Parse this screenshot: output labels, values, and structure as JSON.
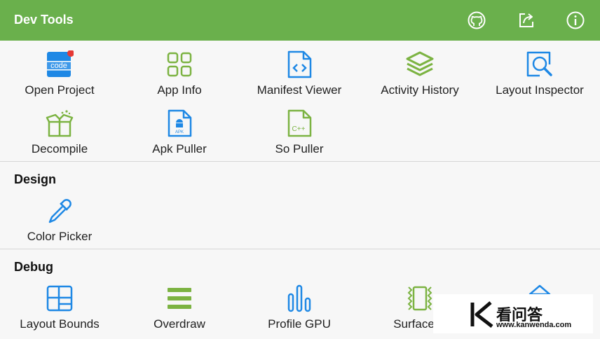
{
  "appbar": {
    "title": "Dev Tools",
    "color": "#6ab04c",
    "actions": [
      {
        "name": "github",
        "icon": "github-icon"
      },
      {
        "name": "share",
        "icon": "share-icon"
      },
      {
        "name": "info",
        "icon": "info-icon"
      }
    ]
  },
  "tools": {
    "items": [
      {
        "label": "Open Project",
        "icon": "code-icon"
      },
      {
        "label": "App Info",
        "icon": "grid-icon"
      },
      {
        "label": "Manifest Viewer",
        "icon": "manifest-file-icon"
      },
      {
        "label": "Activity History",
        "icon": "layers-icon"
      },
      {
        "label": "Layout Inspector",
        "icon": "inspect-icon"
      },
      {
        "label": "Decompile",
        "icon": "box-icon"
      },
      {
        "label": "Apk Puller",
        "icon": "apk-file-icon"
      },
      {
        "label": "So Puller",
        "icon": "cpp-file-icon"
      }
    ]
  },
  "design": {
    "title": "Design",
    "items": [
      {
        "label": "Color Picker",
        "icon": "dropper-icon"
      }
    ]
  },
  "debug": {
    "title": "Debug",
    "items": [
      {
        "label": "Layout Bounds",
        "icon": "bounds-icon"
      },
      {
        "label": "Overdraw",
        "icon": "overdraw-icon"
      },
      {
        "label": "Profile GPU",
        "icon": "bars-icon"
      },
      {
        "label": "Surface U",
        "icon": "surface-icon"
      }
    ]
  },
  "watermark": {
    "name": "看问答",
    "url": "www.kanwenda.com"
  },
  "colors": {
    "blue": "#1e88e5",
    "green": "#7cb342",
    "badge": "#e53935"
  }
}
